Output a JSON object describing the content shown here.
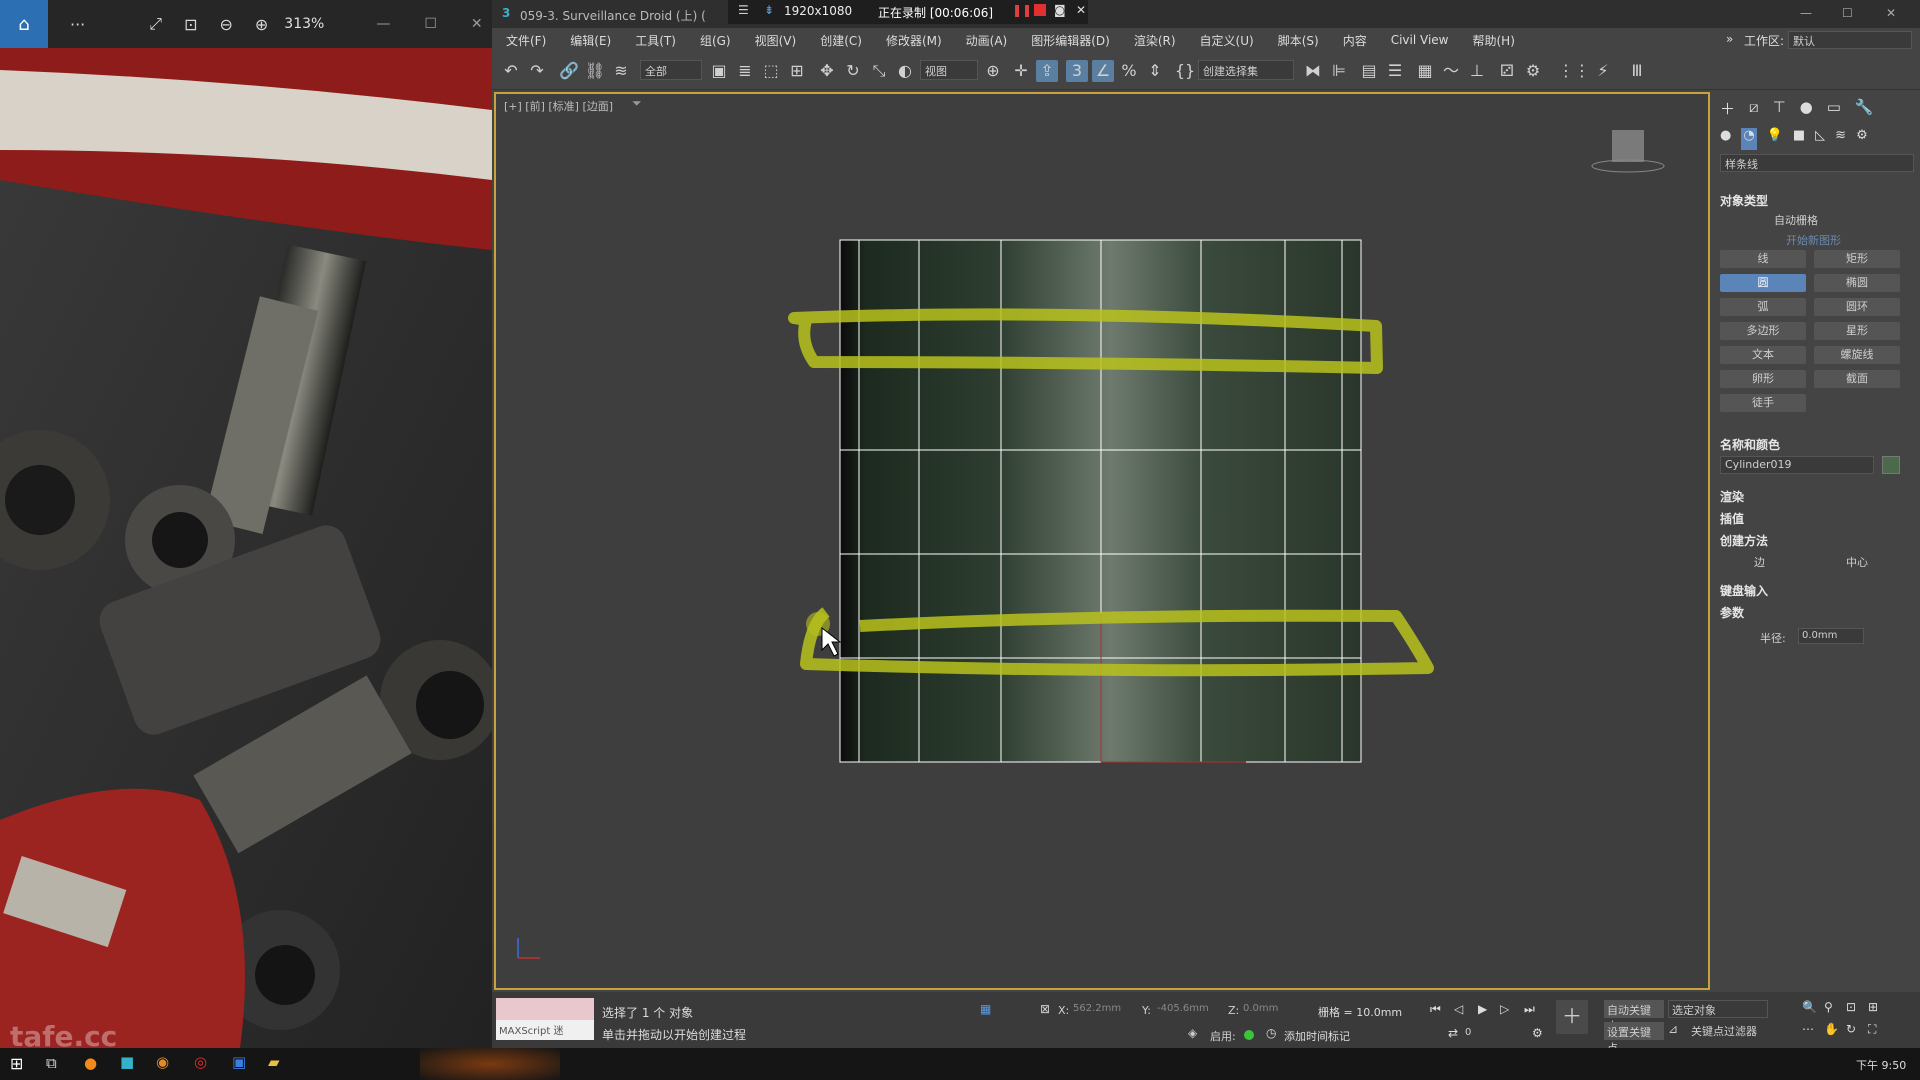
{
  "viewer": {
    "zoom_label": "313%",
    "buttons": [
      "home",
      "more",
      "fullscreen",
      "fit",
      "zoom-out",
      "zoom-in"
    ],
    "watermark": "tafe.cc"
  },
  "titlebar": {
    "app_title": "059-3. Surveillance Droid (上) (",
    "resolution": "1920x1080",
    "recording": "正在录制 [00:06:06]"
  },
  "menu": {
    "items": [
      "文件(F)",
      "编辑(E)",
      "工具(T)",
      "组(G)",
      "视图(V)",
      "创建(C)",
      "修改器(M)",
      "动画(A)",
      "图形编辑器(D)",
      "渲染(R)",
      "自定义(U)",
      "脚本(S)",
      "内容",
      "Civil View",
      "帮助(H)"
    ],
    "workspace_label": "工作区:",
    "workspace_value": "默认"
  },
  "toolbar": {
    "filter": "全部",
    "refcoord": "视图",
    "selection_set": "创建选择集"
  },
  "viewport": {
    "label": "[+] [前] [标准] [边面]",
    "accent": "#c8a23c"
  },
  "cmdpanel": {
    "category": "样条线",
    "object_type_head": "对象类型",
    "auto_grid": "自动栅格",
    "start_new_shape": "开始新图形",
    "shape_buttons": [
      "线",
      "矩形",
      "圆",
      "椭圆",
      "弧",
      "圆环",
      "多边形",
      "星形",
      "文本",
      "螺旋线",
      "卵形",
      "截面",
      "徒手"
    ],
    "selected_shape": "圆",
    "name_color_head": "名称和颜色",
    "object_name": "Cylinder019",
    "rollouts": [
      "渲染",
      "插值"
    ],
    "creation_method_head": "创建方法",
    "method_edge": "边",
    "method_center": "中心",
    "keyboard_entry": "键盘输入",
    "params_head": "参数",
    "radius_label": "半径:",
    "radius_value": "0.0mm"
  },
  "status": {
    "maxscript": "MAXScript 迷",
    "selected": "选择了 1 个 对象",
    "prompt": "单击并拖动以开始创建过程",
    "x_label": "X:",
    "x_value": "562.2mm",
    "y_label": "Y:",
    "y_value": "-405.6mm",
    "z_label": "Z:",
    "z_value": "0.0mm",
    "grid": "栅格 = 10.0mm",
    "enable_label": "启用:",
    "add_time_tag": "添加时间标记",
    "auto_key": "自动关键点",
    "set_key": "设置关键点",
    "key_target": "选定对象",
    "key_filters": "关键点过滤器",
    "frame": "0"
  },
  "taskbar": {
    "clock": "下午 9:50"
  }
}
